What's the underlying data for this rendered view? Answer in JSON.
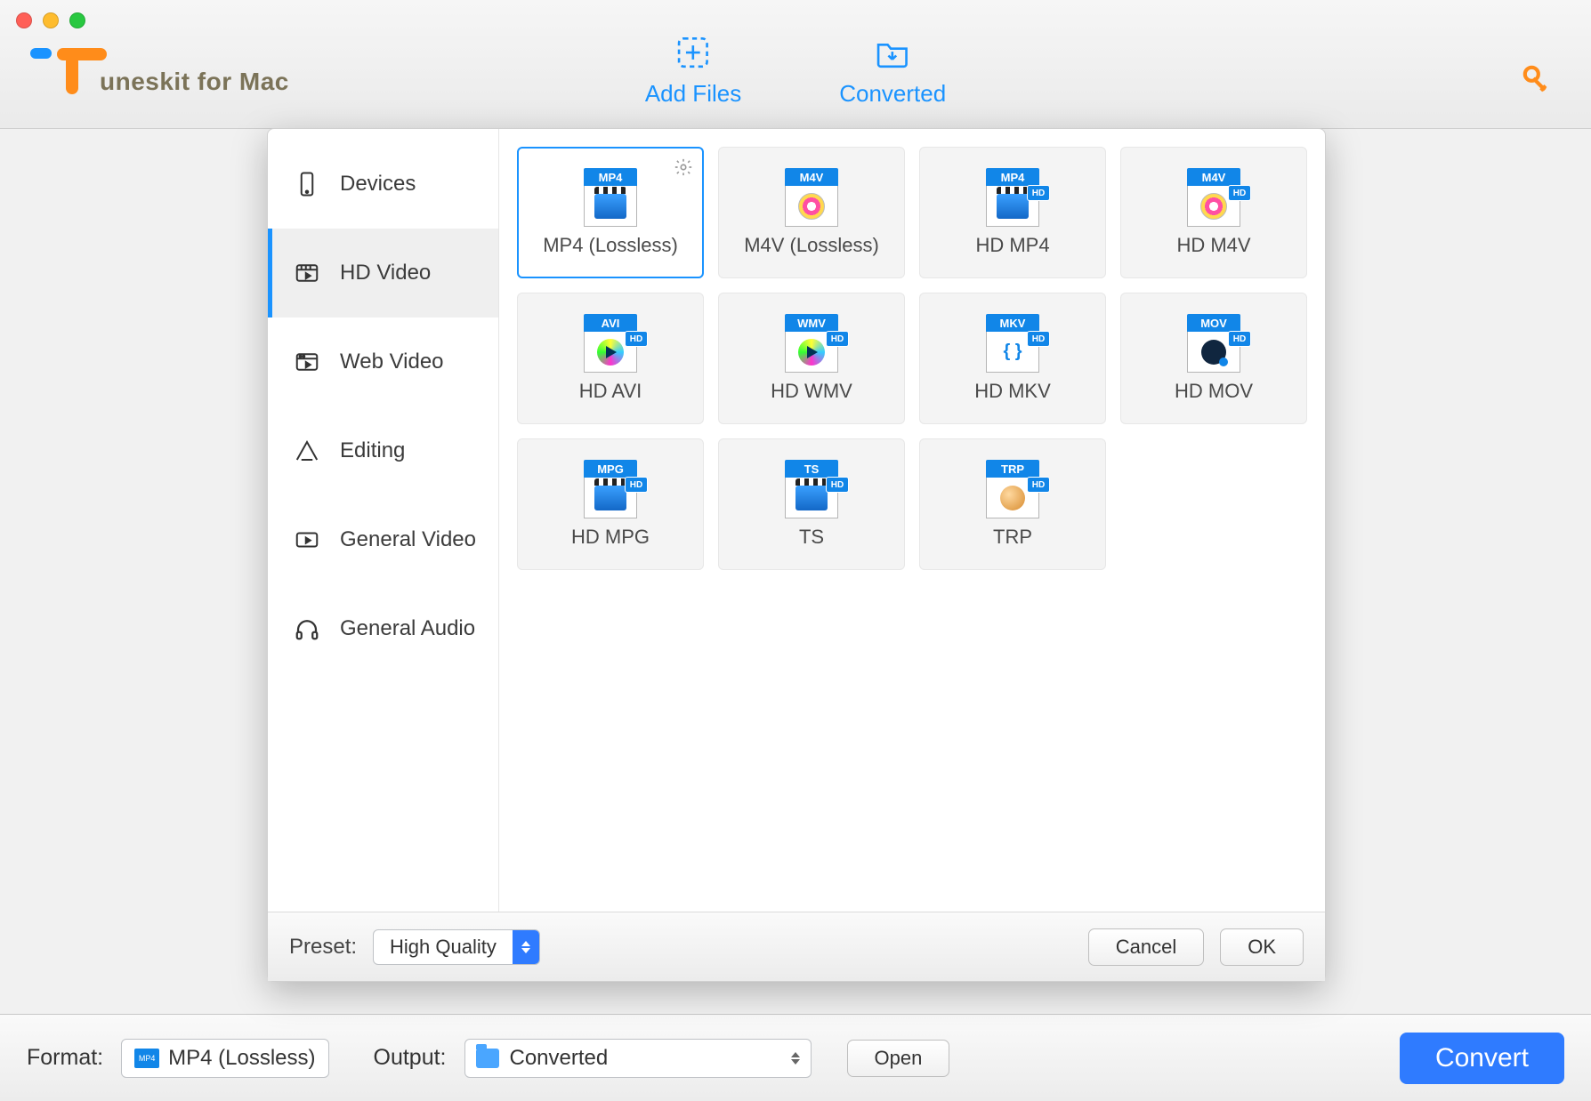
{
  "toolbar": {
    "add_files": "Add Files",
    "converted": "Converted"
  },
  "logo_text": "uneskit for Mac",
  "popover": {
    "sidebar": {
      "devices": "Devices",
      "hd_video": "HD Video",
      "web_video": "Web Video",
      "editing": "Editing",
      "general_video": "General Video",
      "general_audio": "General Audio",
      "active": "hd_video"
    },
    "formats": [
      {
        "tag": "MP4",
        "label": "MP4 (Lossless)",
        "hd": false,
        "body": "movie",
        "selected": true,
        "gear": true
      },
      {
        "tag": "M4V",
        "label": "M4V (Lossless)",
        "hd": false,
        "body": "disc"
      },
      {
        "tag": "MP4",
        "label": "HD MP4",
        "hd": true,
        "body": "movie"
      },
      {
        "tag": "M4V",
        "label": "HD M4V",
        "hd": true,
        "body": "disc"
      },
      {
        "tag": "AVI",
        "label": "HD AVI",
        "hd": true,
        "body": "play"
      },
      {
        "tag": "WMV",
        "label": "HD WMV",
        "hd": true,
        "body": "play"
      },
      {
        "tag": "MKV",
        "label": "HD MKV",
        "hd": true,
        "body": "braces"
      },
      {
        "tag": "MOV",
        "label": "HD MOV",
        "hd": true,
        "body": "qt"
      },
      {
        "tag": "MPG",
        "label": "HD MPG",
        "hd": true,
        "body": "movie"
      },
      {
        "tag": "TS",
        "label": "TS",
        "hd": true,
        "body": "movie"
      },
      {
        "tag": "TRP",
        "label": "TRP",
        "hd": true,
        "body": "ball"
      }
    ],
    "preset_label": "Preset:",
    "preset_value": "High Quality",
    "cancel": "Cancel",
    "ok": "OK"
  },
  "bottom": {
    "format_label": "Format:",
    "format_value": "MP4 (Lossless)",
    "output_label": "Output:",
    "output_value": "Converted",
    "open": "Open",
    "convert": "Convert"
  },
  "colors": {
    "accent": "#1a93ff",
    "brand": "#ff8c1a"
  }
}
